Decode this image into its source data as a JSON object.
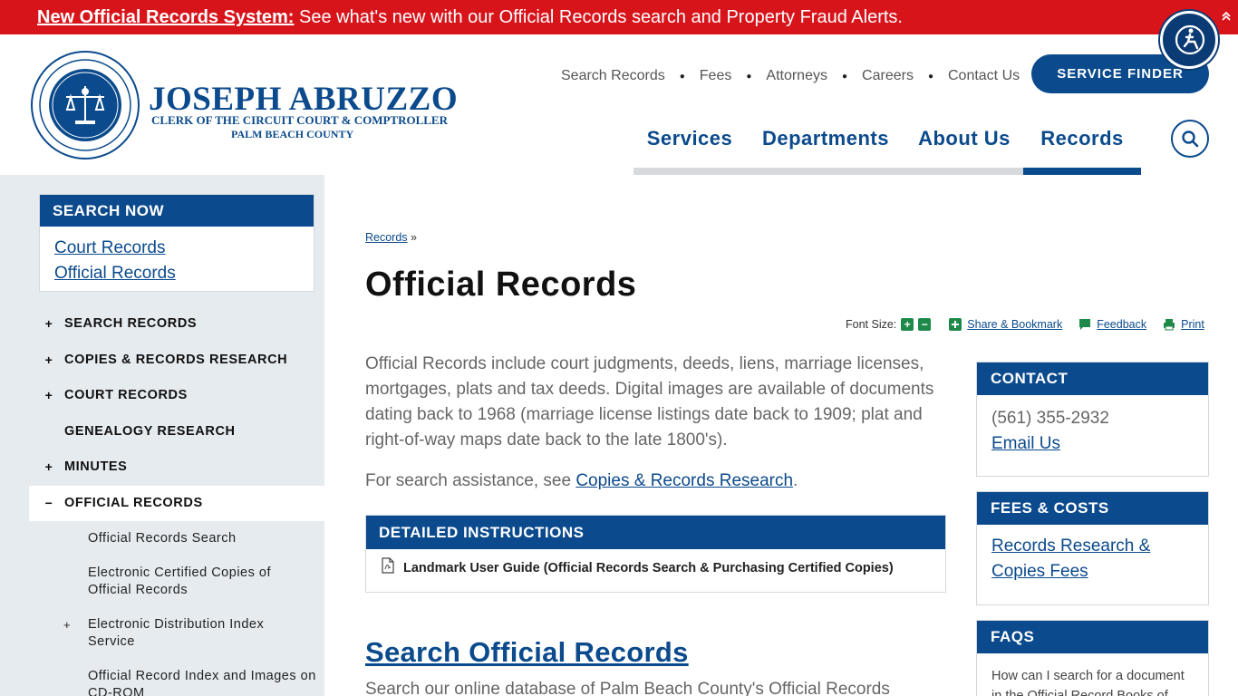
{
  "alert": {
    "link": "New Official Records System:",
    "text": " See what's new with our Official Records search and Property Fraud Alerts."
  },
  "brand": {
    "name": "JOSEPH ABRUZZO",
    "subtitle": "CLERK OF THE CIRCUIT COURT & COMPTROLLER",
    "county": "PALM BEACH COUNTY"
  },
  "util_nav": [
    "Search Records",
    "Fees",
    "Attorneys",
    "Careers",
    "Contact Us"
  ],
  "service_finder": "SERVICE FINDER",
  "main_nav": [
    "Services",
    "Departments",
    "About Us",
    "Records"
  ],
  "sidebar": {
    "search_now": {
      "title": "SEARCH NOW",
      "links": [
        "Court Records",
        "Official Records"
      ]
    },
    "menu": [
      {
        "label": "SEARCH RECORDS",
        "toggle": "+"
      },
      {
        "label": "COPIES & RECORDS RESEARCH",
        "toggle": "+"
      },
      {
        "label": "COURT RECORDS",
        "toggle": "+"
      },
      {
        "label": "GENEALOGY RESEARCH",
        "toggle": ""
      },
      {
        "label": "MINUTES",
        "toggle": "+"
      },
      {
        "label": "OFFICIAL RECORDS",
        "toggle": "−"
      }
    ],
    "submenu": [
      {
        "label": "Official Records Search",
        "toggle": ""
      },
      {
        "label": "Electronic Certified Copies of Official Records",
        "toggle": ""
      },
      {
        "label": "Electronic Distribution Index Service",
        "toggle": "+"
      },
      {
        "label": "Official Record Index and Images on CD-ROM",
        "toggle": ""
      }
    ]
  },
  "breadcrumb": {
    "link": "Records",
    "sep": " »"
  },
  "page_title": "Official Records",
  "tools": {
    "font_size": "Font Size:",
    "plus": "+",
    "minus": "−",
    "share": "Share & Bookmark",
    "feedback": "Feedback",
    "print": "Print"
  },
  "intro": "Official Records include court judgments, deeds, liens, marriage licenses, mortgages, plats and tax deeds. Digital images are available of documents dating back to 1968 (marriage license listings date back to 1909; plat and right-of-way maps date back to the late 1800's).",
  "assist": {
    "prefix": "For search assistance, see ",
    "link": "Copies & Records Research",
    "suffix": "."
  },
  "instructions": {
    "title": "DETAILED INSTRUCTIONS",
    "item": "Landmark User Guide (Official Records Search & Purchasing Certified Copies)"
  },
  "section": {
    "heading": "Search Official Records",
    "text": "Search our online database of Palm Beach County's Official Records"
  },
  "contact": {
    "title": "CONTACT",
    "phone": "(561) 355-2932",
    "email": "Email Us"
  },
  "fees": {
    "title": "FEES & COSTS",
    "link_line1": "Records Research &",
    "link_line2": "Copies Fees"
  },
  "faqs": {
    "title": "FAQS",
    "q1": "How can I search for a document",
    "q1_cont": "in the Official Record Books of"
  },
  "colors": {
    "brand_blue": "#0b4a8c",
    "alert_red": "#d8141b",
    "sidebar_bg": "#e6ebf0"
  }
}
